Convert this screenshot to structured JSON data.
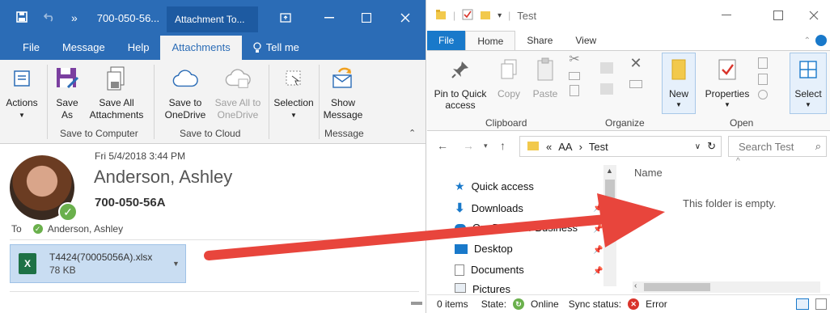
{
  "outlook": {
    "quick_access": {
      "more": "»"
    },
    "title": "700-050-56...",
    "context_tab": "Attachment To...",
    "tabs": [
      "File",
      "Message",
      "Help",
      "Attachments",
      "Tell me"
    ],
    "ribbon": {
      "actions": "Actions",
      "save_as": "Save As",
      "save_all": "Save All Attachments",
      "save_to_onedrive": "Save to OneDrive",
      "save_all_to_onedrive": "Save All to OneDrive",
      "selection": "Selection",
      "show_message": "Show Message",
      "groups": [
        "Save to Computer",
        "Save to Cloud",
        "Message"
      ]
    },
    "message": {
      "date": "Fri 5/4/2018 3:44 PM",
      "from": "Anderson, Ashley",
      "subject": "700-050-56A",
      "to_label": "To",
      "to": "Anderson, Ashley",
      "attachment": {
        "name": "T4424(70005056A).xlsx",
        "size": "78 KB",
        "badge": "X"
      }
    }
  },
  "explorer": {
    "title": "Test",
    "tabs": [
      "File",
      "Home",
      "Share",
      "View"
    ],
    "ribbon": {
      "pin": "Pin to Quick access",
      "copy": "Copy",
      "paste": "Paste",
      "new": "New",
      "properties": "Properties",
      "select": "Select",
      "groups": {
        "clipboard": "Clipboard",
        "organize": "Organize",
        "open": "Open"
      }
    },
    "address": {
      "prefix": "«",
      "path": [
        "AA",
        "Test"
      ]
    },
    "search_placeholder": "Search Test",
    "nav": [
      "Quick access",
      "Downloads",
      "OneDrive for Business",
      "Desktop",
      "Documents",
      "Pictures"
    ],
    "column_name": "Name",
    "empty_message": "This folder is empty.",
    "status": {
      "items": "0 items",
      "state_label": "State:",
      "state": "Online",
      "sync_label": "Sync status:",
      "sync": "Error"
    }
  },
  "colors": {
    "outlook_blue": "#2b6cb6",
    "explorer_file": "#1979ca",
    "arrow": "#e8453c",
    "ok_green": "#6ab04c",
    "error_red": "#d9342b"
  }
}
